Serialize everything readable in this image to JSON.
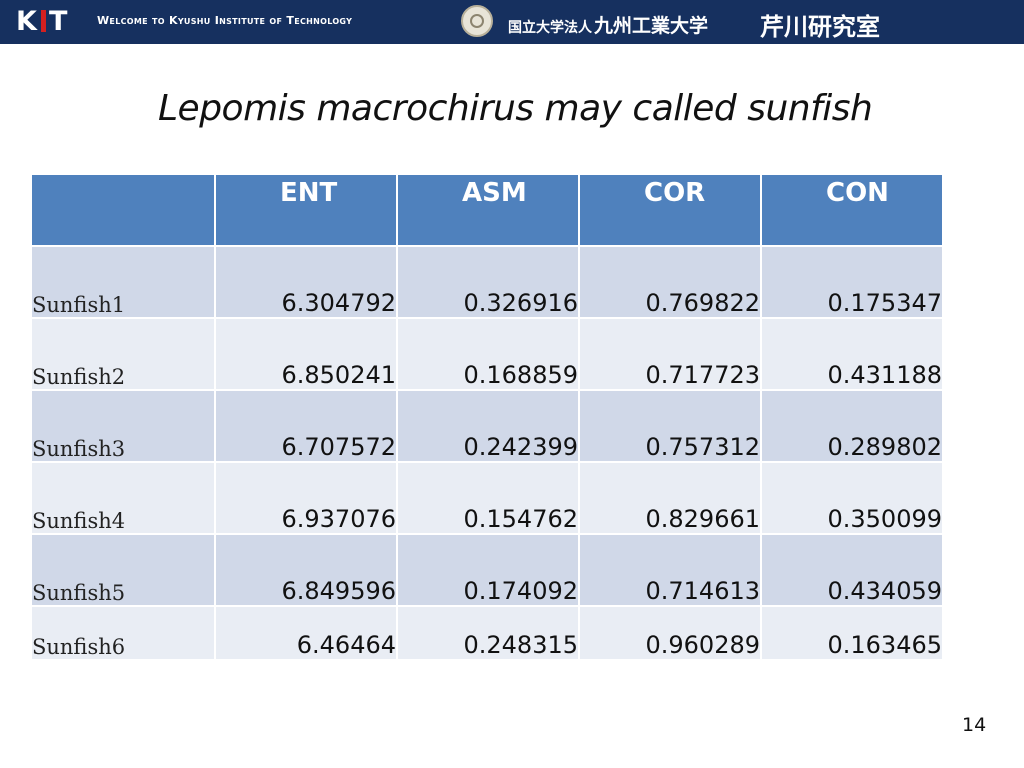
{
  "header": {
    "logo_text": "KIT",
    "welcome": "Welcome to Kyushu Institute of Technology",
    "university_prefix": "国立大学法人",
    "university_name": "九州工業大学",
    "lab_name": "芹川研究室"
  },
  "slide": {
    "title": "Lepomis macrochirus  may called sunfish",
    "page_number": "14"
  },
  "table": {
    "columns": [
      "",
      "ENT",
      "ASM",
      "COR",
      "CON"
    ],
    "rows": [
      [
        "Sunfish1",
        "6.304792",
        "0.326916",
        "0.769822",
        "0.175347"
      ],
      [
        "Sunfish2",
        "6.850241",
        "0.168859",
        "0.717723",
        "0.431188"
      ],
      [
        "Sunfish3",
        "6.707572",
        "0.242399",
        "0.757312",
        "0.289802"
      ],
      [
        "Sunfish4",
        "6.937076",
        "0.154762",
        "0.829661",
        "0.350099"
      ],
      [
        "Sunfish5",
        "6.849596",
        "0.174092",
        "0.714613",
        "0.434059"
      ],
      [
        "Sunfish6",
        "6.46464",
        "0.248315",
        "0.960289",
        "0.163465"
      ]
    ]
  },
  "colors": {
    "banner": "#16305f",
    "header_cell": "#4f81bd",
    "row_odd": "#d0d8e8",
    "row_even": "#e9edf4"
  }
}
